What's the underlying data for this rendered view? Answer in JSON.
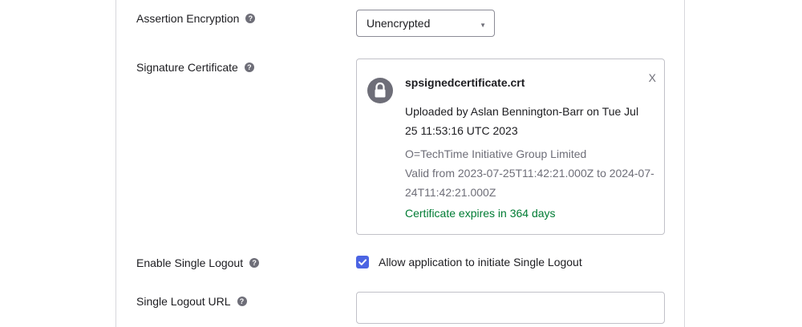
{
  "form": {
    "assertion_encryption": {
      "label": "Assertion Encryption",
      "help_icon": "help-icon",
      "selected": "Unencrypted"
    },
    "signature_certificate": {
      "label": "Signature Certificate",
      "help_icon": "help-icon",
      "lock_icon": "lock-icon",
      "file_name": "spsignedcertificate.crt",
      "close_label": "X",
      "uploaded_by": "Uploaded by Aslan Bennington-Barr on Tue Jul 25 11:53:16 UTC 2023",
      "organization": "O=TechTime Initiative Group Limited",
      "validity": "Valid from 2023-07-25T11:42:21.000Z to 2024-07-24T11:42:21.000Z",
      "expiry": "Certificate expires in 364 days"
    },
    "single_logout": {
      "label": "Enable Single Logout",
      "help_icon": "help-icon",
      "checked": true,
      "checkbox_label": "Allow application to initiate Single Logout"
    },
    "single_logout_url": {
      "label": "Single Logout URL",
      "help_icon": "help-icon",
      "value": ""
    }
  },
  "colors": {
    "accent": "#4b64e3",
    "success": "#007c34",
    "muted": "#6e6e78"
  }
}
